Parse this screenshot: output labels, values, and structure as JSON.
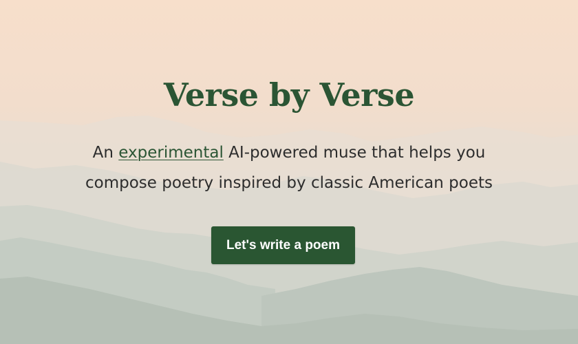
{
  "hero": {
    "title": "Verse by Verse",
    "subtitle_prefix": "An ",
    "subtitle_link": "experimental",
    "subtitle_line1_rest": " AI-powered muse that helps you",
    "subtitle_line2": "compose poetry inspired by classic American poets",
    "cta_label": "Let's write a poem",
    "background": "misty-mountain-range"
  },
  "colors": {
    "brand_green": "#2a5632",
    "title_green": "#2b5534",
    "text_dark": "#2d2d2d",
    "sky_top": "#f7dfcb"
  }
}
